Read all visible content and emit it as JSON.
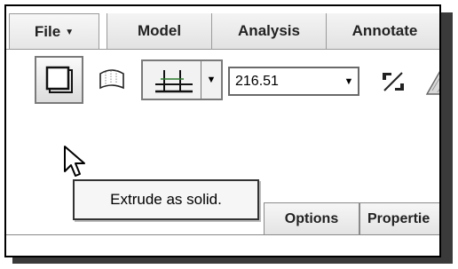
{
  "ribbon": {
    "tabs": [
      {
        "label": "File",
        "has_menu": true
      },
      {
        "label": "Model"
      },
      {
        "label": "Analysis"
      },
      {
        "label": "Annotate"
      }
    ]
  },
  "toolbar": {
    "extrude_solid_icon": "solid-square-icon",
    "extrude_surface_icon": "surface-outline-icon",
    "depth_option_icon": "blind-depth-icon",
    "depth_value": "216.51",
    "flip_icon": "flip-direction-icon",
    "remove_material_icon": "remove-material-icon"
  },
  "tooltip": {
    "text": "Extrude as solid."
  },
  "dashboard": {
    "tabs": [
      "Options",
      "Propertie"
    ]
  },
  "colors": {
    "frame_border": "#000000",
    "button_border": "#7a7a7a",
    "tab_bg": "#e8e8e8",
    "shadow": "#3a3a3a"
  }
}
